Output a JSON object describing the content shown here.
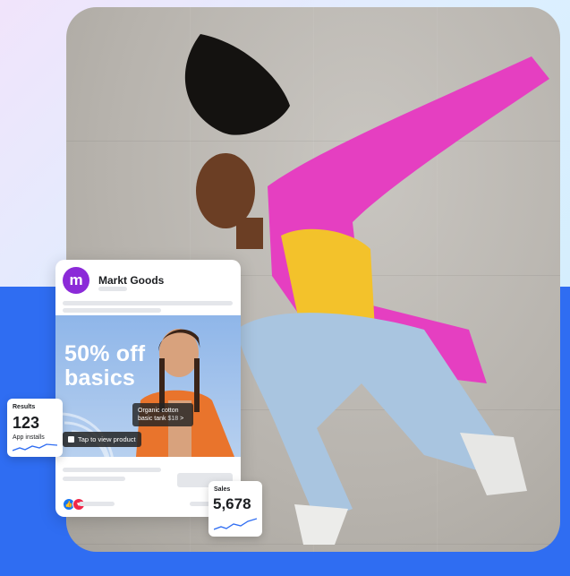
{
  "ad": {
    "brand_initial": "m",
    "brand_name": "Markt Goods",
    "promo_line1": "50% off",
    "promo_line2": "basics",
    "product_line1": "Organic cotton",
    "product_line2": "basic tank",
    "product_price": "$18",
    "product_chevron": ">",
    "cta": "Tap to view product",
    "reaction_like": "👍",
    "reaction_love": "♥"
  },
  "results": {
    "label": "Results",
    "value": "123",
    "sublabel": "App installs"
  },
  "sales": {
    "label": "Sales",
    "value": "5,678"
  },
  "colors": {
    "brand_purple": "#8b2ad8",
    "accent_blue": "#2f6df2",
    "jacket_pink": "#e53fc1",
    "top_yellow": "#f3c22b"
  }
}
